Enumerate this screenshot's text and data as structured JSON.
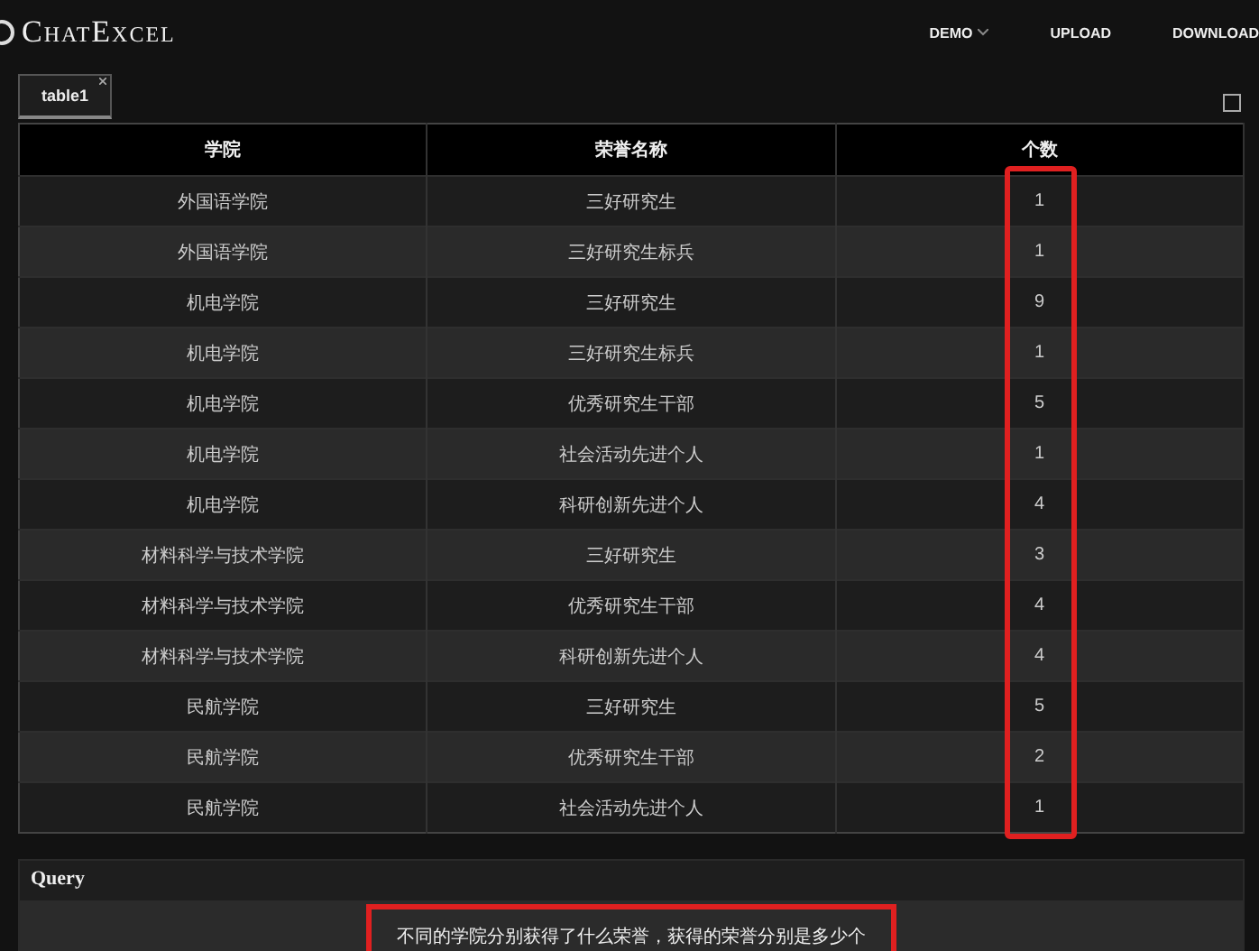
{
  "header": {
    "logo": "ChatExcel",
    "nav": [
      {
        "label": "DEMO",
        "kind": "dropdown"
      },
      {
        "label": "UPLOAD",
        "kind": "link"
      },
      {
        "label": "DOWNLOAD",
        "kind": "link"
      }
    ]
  },
  "tabs": [
    {
      "label": "table1",
      "selected": true
    }
  ],
  "table": {
    "columns": [
      {
        "label": "学院",
        "highlighted": false
      },
      {
        "label": "荣誉名称",
        "highlighted": false
      },
      {
        "label": "个数",
        "highlighted": true
      }
    ],
    "rows": [
      [
        "外国语学院",
        "三好研究生",
        "1"
      ],
      [
        "外国语学院",
        "三好研究生标兵",
        "1"
      ],
      [
        "机电学院",
        "三好研究生",
        "9"
      ],
      [
        "机电学院",
        "三好研究生标兵",
        "1"
      ],
      [
        "机电学院",
        "优秀研究生干部",
        "5"
      ],
      [
        "机电学院",
        "社会活动先进个人",
        "1"
      ],
      [
        "机电学院",
        "科研创新先进个人",
        "4"
      ],
      [
        "材料科学与技术学院",
        "三好研究生",
        "3"
      ],
      [
        "材料科学与技术学院",
        "优秀研究生干部",
        "4"
      ],
      [
        "材料科学与技术学院",
        "科研创新先进个人",
        "4"
      ],
      [
        "民航学院",
        "三好研究生",
        "5"
      ],
      [
        "民航学院",
        "优秀研究生干部",
        "2"
      ],
      [
        "民航学院",
        "社会活动先进个人",
        "1"
      ]
    ]
  },
  "query": {
    "label": "Query",
    "value": "不同的学院分别获得了什么荣誉，获得的荣誉分别是多少个",
    "highlighted": true
  }
}
